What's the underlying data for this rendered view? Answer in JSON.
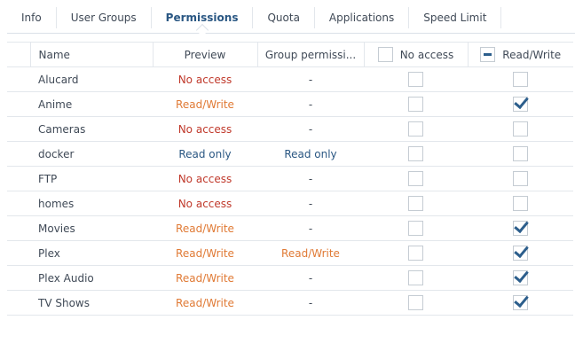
{
  "tabs": [
    {
      "label": "Info"
    },
    {
      "label": "User Groups"
    },
    {
      "label": "Permissions",
      "active": true
    },
    {
      "label": "Quota"
    },
    {
      "label": "Applications"
    },
    {
      "label": "Speed Limit"
    }
  ],
  "columns": {
    "name": "Name",
    "preview": "Preview",
    "group": "Group permissi...",
    "no_access": "No access",
    "read_write": "Read/Write"
  },
  "header_checks": {
    "no_access": "unchecked",
    "read_write": "partial"
  },
  "colors": {
    "no_access": "#c0392b",
    "read_write": "#e07a35",
    "read_only": "#2a5783"
  },
  "rows": [
    {
      "name": "Alucard",
      "preview": "No access",
      "group": "-",
      "no_access": false,
      "read_write": false
    },
    {
      "name": "Anime",
      "preview": "Read/Write",
      "group": "-",
      "no_access": false,
      "read_write": true
    },
    {
      "name": "Cameras",
      "preview": "No access",
      "group": "-",
      "no_access": false,
      "read_write": false
    },
    {
      "name": "docker",
      "preview": "Read only",
      "group": "Read only",
      "no_access": false,
      "read_write": false
    },
    {
      "name": "FTP",
      "preview": "No access",
      "group": "-",
      "no_access": false,
      "read_write": false
    },
    {
      "name": "homes",
      "preview": "No access",
      "group": "-",
      "no_access": false,
      "read_write": false
    },
    {
      "name": "Movies",
      "preview": "Read/Write",
      "group": "-",
      "no_access": false,
      "read_write": true
    },
    {
      "name": "Plex",
      "preview": "Read/Write",
      "group": "Read/Write",
      "no_access": false,
      "read_write": true
    },
    {
      "name": "Plex Audio",
      "preview": "Read/Write",
      "group": "-",
      "no_access": false,
      "read_write": true
    },
    {
      "name": "TV Shows",
      "preview": "Read/Write",
      "group": "-",
      "no_access": false,
      "read_write": true
    }
  ]
}
